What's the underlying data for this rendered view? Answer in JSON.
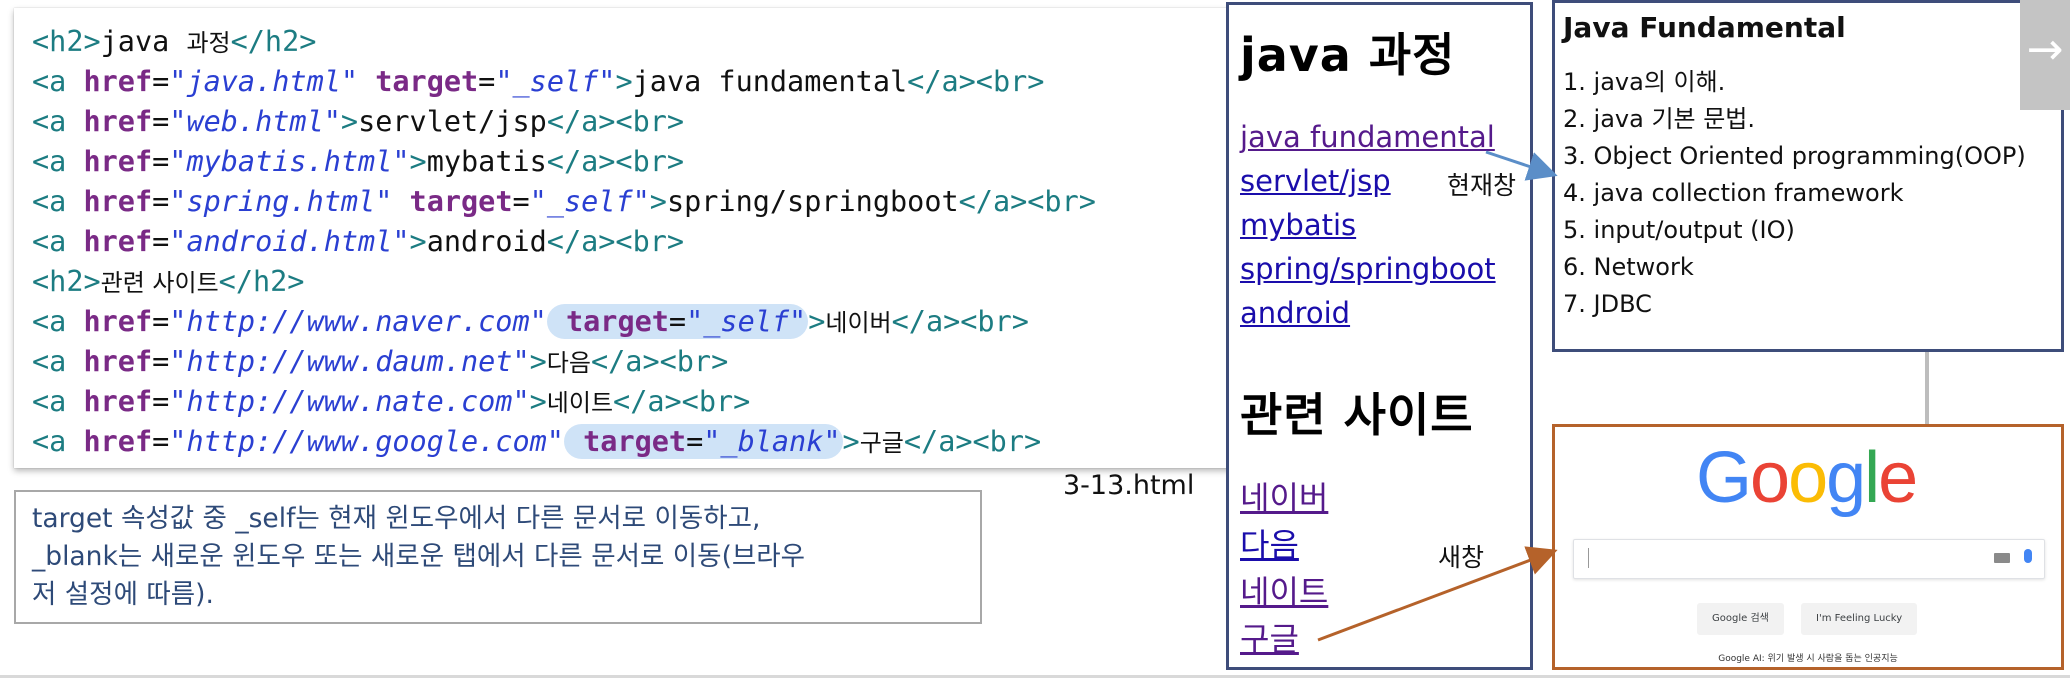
{
  "code": {
    "lines": [
      {
        "tokens": [
          {
            "t": "tag",
            "v": "<h2>"
          },
          {
            "t": "txt",
            "v": "java "
          },
          {
            "t": "ko",
            "v": "과정"
          },
          {
            "t": "tag",
            "v": "</h2>"
          }
        ]
      },
      {
        "tokens": [
          {
            "t": "tag",
            "v": "<a "
          },
          {
            "t": "attr",
            "v": "href"
          },
          {
            "t": "eq",
            "v": "="
          },
          {
            "t": "val",
            "v": "\"java.html\""
          },
          {
            "t": "txt",
            "v": " "
          },
          {
            "t": "attr",
            "v": "target"
          },
          {
            "t": "eq",
            "v": "="
          },
          {
            "t": "val",
            "v": "\"_self\""
          },
          {
            "t": "tag",
            "v": ">"
          },
          {
            "t": "txt",
            "v": "java fundamental"
          },
          {
            "t": "tag",
            "v": "</a><br>"
          }
        ]
      },
      {
        "tokens": [
          {
            "t": "tag",
            "v": "<a "
          },
          {
            "t": "attr",
            "v": "href"
          },
          {
            "t": "eq",
            "v": "="
          },
          {
            "t": "val",
            "v": "\"web.html\""
          },
          {
            "t": "tag",
            "v": ">"
          },
          {
            "t": "txt",
            "v": "servlet/jsp"
          },
          {
            "t": "tag",
            "v": "</a><br>"
          }
        ]
      },
      {
        "tokens": [
          {
            "t": "tag",
            "v": "<a "
          },
          {
            "t": "attr",
            "v": "href"
          },
          {
            "t": "eq",
            "v": "="
          },
          {
            "t": "val",
            "v": "\"mybatis.html\""
          },
          {
            "t": "tag",
            "v": ">"
          },
          {
            "t": "txt",
            "v": "mybatis"
          },
          {
            "t": "tag",
            "v": "</a><br>"
          }
        ]
      },
      {
        "tokens": [
          {
            "t": "tag",
            "v": "<a "
          },
          {
            "t": "attr",
            "v": "href"
          },
          {
            "t": "eq",
            "v": "="
          },
          {
            "t": "val",
            "v": "\"spring.html\""
          },
          {
            "t": "txt",
            "v": " "
          },
          {
            "t": "attr",
            "v": "target"
          },
          {
            "t": "eq",
            "v": "="
          },
          {
            "t": "val",
            "v": "\"_self\""
          },
          {
            "t": "tag",
            "v": ">"
          },
          {
            "t": "txt",
            "v": "spring/springboot"
          },
          {
            "t": "tag",
            "v": "</a><br>"
          }
        ]
      },
      {
        "tokens": [
          {
            "t": "tag",
            "v": "<a "
          },
          {
            "t": "attr",
            "v": "href"
          },
          {
            "t": "eq",
            "v": "="
          },
          {
            "t": "val",
            "v": "\"android.html\""
          },
          {
            "t": "tag",
            "v": ">"
          },
          {
            "t": "txt",
            "v": "android"
          },
          {
            "t": "tag",
            "v": "</a><br>"
          }
        ]
      },
      {
        "tokens": [
          {
            "t": "tag",
            "v": "<h2>"
          },
          {
            "t": "ko",
            "v": "관련 사이트"
          },
          {
            "t": "tag",
            "v": "</h2>"
          }
        ]
      },
      {
        "tokens": [
          {
            "t": "tag",
            "v": "<a "
          },
          {
            "t": "attr",
            "v": "href"
          },
          {
            "t": "eq",
            "v": "="
          },
          {
            "t": "val",
            "v": "\"http://www.naver.com\""
          },
          {
            "t": "hl",
            "v": [
              {
                "t": "txt",
                "v": " "
              },
              {
                "t": "attr",
                "v": "target"
              },
              {
                "t": "eq",
                "v": "="
              },
              {
                "t": "val",
                "v": "\"_self\""
              }
            ]
          },
          {
            "t": "tag",
            "v": ">"
          },
          {
            "t": "ko",
            "v": "네이버"
          },
          {
            "t": "tag",
            "v": "</a><br>"
          }
        ]
      },
      {
        "tokens": [
          {
            "t": "tag",
            "v": "<a "
          },
          {
            "t": "attr",
            "v": "href"
          },
          {
            "t": "eq",
            "v": "="
          },
          {
            "t": "val",
            "v": "\"http://www.daum.net\""
          },
          {
            "t": "tag",
            "v": ">"
          },
          {
            "t": "ko",
            "v": "다음"
          },
          {
            "t": "tag",
            "v": "</a><br>"
          }
        ]
      },
      {
        "tokens": [
          {
            "t": "tag",
            "v": "<a "
          },
          {
            "t": "attr",
            "v": "href"
          },
          {
            "t": "eq",
            "v": "="
          },
          {
            "t": "val",
            "v": "\"http://www.nate.com\""
          },
          {
            "t": "tag",
            "v": ">"
          },
          {
            "t": "ko",
            "v": "네이트"
          },
          {
            "t": "tag",
            "v": "</a><br>"
          }
        ]
      },
      {
        "tokens": [
          {
            "t": "tag",
            "v": "<a "
          },
          {
            "t": "attr",
            "v": "href"
          },
          {
            "t": "eq",
            "v": "="
          },
          {
            "t": "val",
            "v": "\"http://www.google.com\""
          },
          {
            "t": "hl",
            "v": [
              {
                "t": "txt",
                "v": " "
              },
              {
                "t": "attr",
                "v": "target"
              },
              {
                "t": "eq",
                "v": "="
              },
              {
                "t": "val",
                "v": "\"_blank\""
              }
            ]
          },
          {
            "t": "tag",
            "v": ">"
          },
          {
            "t": "ko",
            "v": "구글"
          },
          {
            "t": "tag",
            "v": "</a><br>"
          }
        ]
      }
    ]
  },
  "note": {
    "line1": "target 속성값 중 _self는 현재 윈도우에서 다른 문서로 이동하고,",
    "line2": "_blank는 새로운 윈도우 또는  새로운 탭에서 다른 문서로 이동(브라우",
    "line3": "저 설정에 따름)."
  },
  "filename": "3-13.html",
  "preview": {
    "heading1": "java 과정",
    "links1": [
      "java fundamental",
      "servlet/jsp",
      "mybatis",
      "spring/springboot",
      "android"
    ],
    "heading2": "관련 사이트",
    "links2": [
      "네이버",
      "다음",
      "네이트",
      "구글"
    ]
  },
  "labels": {
    "current_window": "현재창",
    "new_window": "새창"
  },
  "java_window": {
    "title": "Java Fundamental",
    "items": [
      "1. java의 이해.",
      "2. java 기본 문법.",
      "3. Object Oriented programming(OOP)",
      "4. java collection framework",
      "5. input/output (IO)",
      "6. Network",
      "7. JDBC"
    ]
  },
  "google_window": {
    "logo_letters": [
      {
        "ch": "G",
        "color": "#4285f4"
      },
      {
        "ch": "o",
        "color": "#ea4335"
      },
      {
        "ch": "o",
        "color": "#fbbc05"
      },
      {
        "ch": "g",
        "color": "#4285f4"
      },
      {
        "ch": "l",
        "color": "#34a853"
      },
      {
        "ch": "e",
        "color": "#ea4335"
      }
    ],
    "search_button": "Google 검색",
    "lucky_button": "I'm Feeling Lucky",
    "footer": "Google AI: 위기 발생 시 사람을 돕는 인공지능"
  },
  "nav": {
    "next_icon": "→"
  },
  "colors": {
    "current_arrow": "#5b8ec8",
    "new_arrow": "#b5622a"
  }
}
